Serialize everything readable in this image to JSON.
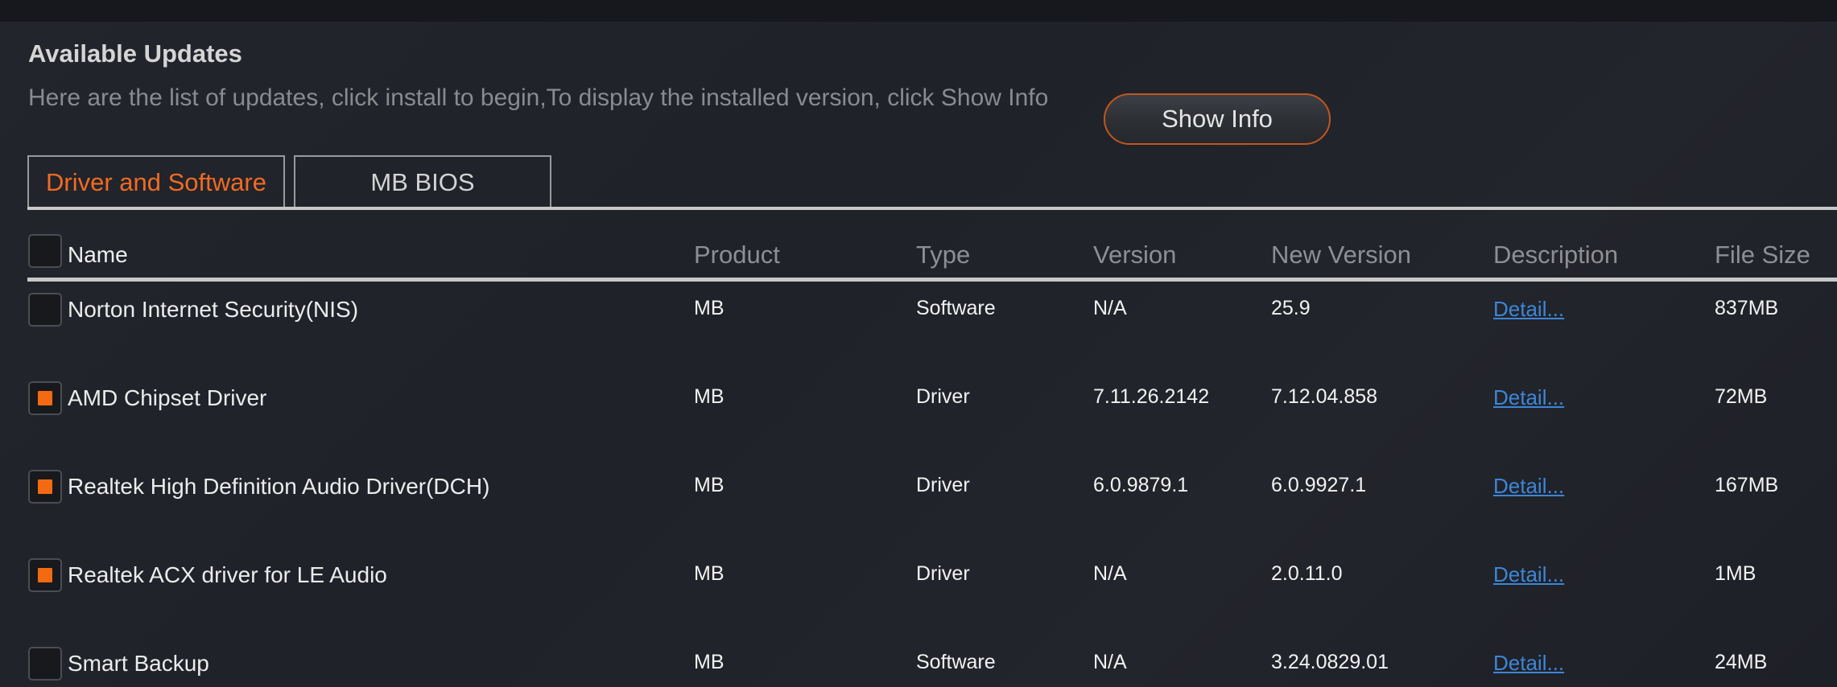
{
  "header": {
    "title": "Available Updates",
    "subtitle": "Here are the list of updates, click install to begin,To display the installed version, click Show Info",
    "show_info_label": "Show Info"
  },
  "tabs": [
    {
      "label": "Driver and Software",
      "active": true
    },
    {
      "label": "MB BIOS",
      "active": false
    }
  ],
  "table": {
    "columns": [
      "Name",
      "Product",
      "Type",
      "Version",
      "New Version",
      "Description",
      "File Size"
    ],
    "select_all_checked": false,
    "rows": [
      {
        "checked": false,
        "name": "Norton Internet Security(NIS)",
        "product": "MB",
        "type": "Software",
        "version": "N/A",
        "new_version": "25.9",
        "description": "Detail...",
        "size": "837MB"
      },
      {
        "checked": true,
        "name": "AMD Chipset Driver",
        "product": "MB",
        "type": "Driver",
        "version": "7.11.26.2142",
        "new_version": "7.12.04.858",
        "description": "Detail...",
        "size": "72MB"
      },
      {
        "checked": true,
        "name": "Realtek  High Definition Audio Driver(DCH)",
        "product": "MB",
        "type": "Driver",
        "version": "6.0.9879.1",
        "new_version": "6.0.9927.1",
        "description": "Detail...",
        "size": "167MB"
      },
      {
        "checked": true,
        "name": "Realtek ACX driver for LE Audio",
        "product": "MB",
        "type": "Driver",
        "version": "N/A",
        "new_version": "2.0.11.0",
        "description": "Detail...",
        "size": "1MB"
      },
      {
        "checked": false,
        "name": "Smart Backup",
        "product": "MB",
        "type": "Software",
        "version": "N/A",
        "new_version": "3.24.0829.01",
        "description": "Detail...",
        "size": "24MB"
      }
    ]
  },
  "colors": {
    "accent": "#f36a12",
    "link": "#3d86d8",
    "background": "#1e2128"
  }
}
